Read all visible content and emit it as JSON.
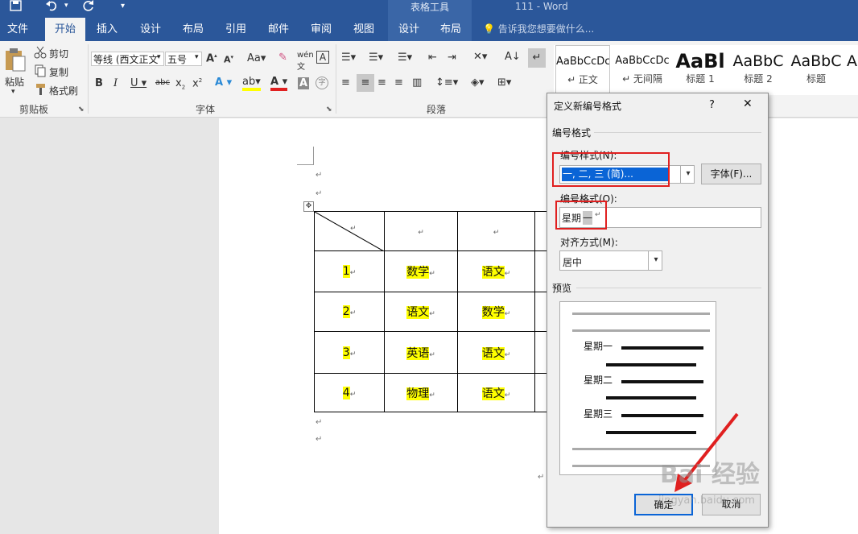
{
  "app": {
    "doc_title": "111 - Word",
    "context_group": "表格工具"
  },
  "tabs": [
    "文件",
    "开始",
    "插入",
    "设计",
    "布局",
    "引用",
    "邮件",
    "审阅",
    "视图",
    "设计",
    "布局"
  ],
  "tell_me": "告诉我您想要做什么...",
  "clipboard": {
    "paste": "粘贴",
    "cut": "剪切",
    "copy": "复制",
    "format_painter": "格式刷",
    "group_label": "剪贴板"
  },
  "font": {
    "name_value": "等线 (西文正文",
    "size_value": "五号",
    "group_label": "字体"
  },
  "paragraph": {
    "group_label": "段落"
  },
  "styles": [
    {
      "sample": "AaBbCcDc",
      "name": "↵ 正文"
    },
    {
      "sample": "AaBbCcDc",
      "name": "↵ 无间隔"
    },
    {
      "sample": "AaBl",
      "name": "标题 1"
    },
    {
      "sample": "AaBbC",
      "name": "标题 2"
    },
    {
      "sample": "AaBbC",
      "name": "标题"
    },
    {
      "sample": "A",
      "name": ""
    }
  ],
  "document": {
    "paragraph_mark": "↵",
    "table": {
      "rows": [
        [
          "1",
          "数学",
          "语文"
        ],
        [
          "2",
          "语文",
          "数学"
        ],
        [
          "3",
          "英语",
          "语文"
        ],
        [
          "4",
          "物理",
          "语文"
        ]
      ]
    }
  },
  "dialog": {
    "title": "定义新编号格式",
    "help": "?",
    "close": "✕",
    "section_number_format": "编号格式",
    "number_style_label": "编号样式(N):",
    "number_style_value": "一, 二, 三 (简)...",
    "font_button": "字体(F)...",
    "number_format_label": "编号格式(O):",
    "number_format_prefix": "星期",
    "number_format_field": "一",
    "alignment_label": "对齐方式(M):",
    "alignment_value": "居中",
    "preview_label": "预览",
    "preview_items": [
      "星期一",
      "星期二",
      "星期三"
    ],
    "ok": "确定",
    "cancel": "取消"
  },
  "watermark": {
    "brand": "Bai 经验",
    "url": "jingyan.baidu.com"
  },
  "colors": {
    "word_blue": "#2b579a",
    "highlight": "#ffff00",
    "annotation_red": "#e02020"
  }
}
